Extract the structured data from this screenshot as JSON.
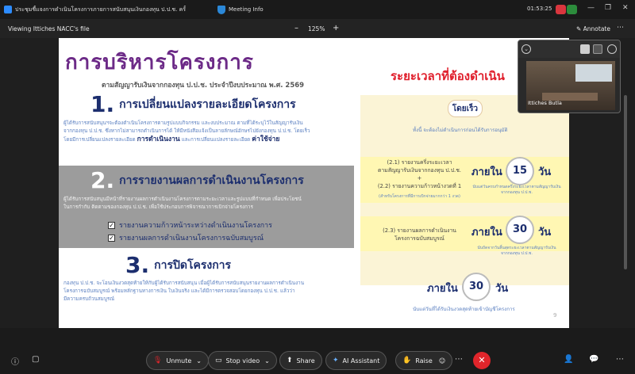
{
  "window": {
    "title": "ประชุมชี้แจงการดำเนินโครงการภายการสนับสนุนเงินกองทุน ป.ป.ช. ครั้งที่ 1/2...",
    "meeting_info": "Meeting Info",
    "time": "01:53:25"
  },
  "viewbar": {
    "viewing": "Viewing Ittiches NACC's file",
    "zoom": "125%",
    "annotate": "Annotate"
  },
  "slide": {
    "title": "การบริหารโครงการ",
    "subtitle": "ตามสัญญารับเงินจากกองทุน ป.ป.ช. ประจำปีงบประมาณ พ.ศ. 2569",
    "s1": {
      "num": "1.",
      "heading": "การเปลี่ยนแปลงรายละเอียดโครงการ",
      "body1": "ผู้ได้รับการสนับสนุนฯจะต้องดำเนินโครงการตามรูปแบบกิจกรรม และงบประมาณ ตามที่ได้ระบุไว้ในสัญญารับเงิน",
      "body2": "จากกองทุน ป.ป.ช. ซึ่งหากไม่สามารถดำเนินการได้ ให้มีหนังสือแจ้งเป็นลายลักษณ์อักษรไปยังกองทุน ป.ป.ช. โดยเร็ว",
      "body3": "โดยมีการเปลี่ยนแปลงรายละเอียด",
      "hl1": "การดำเนินงาน",
      "mid": "และการเปลี่ยนแปลงรายละเอียด",
      "hl2": "ค่าใช้จ่าย"
    },
    "s2": {
      "num": "2.",
      "heading": "การรายงานผลการดำเนินงานโครงการ",
      "body1": "ผู้ได้รับการสนับสนุนมีหน้าที่รายงานผลการดำเนินงานโครงการตามระยะเวลาและรูปแบบที่กำหนด เพื่อประโยชน์",
      "body2": "ในการกำกับ ติดตามของกองทุน ป.ป.ช. เพื่อใช้ประกอบการพิจารณาการเบิกจ่ายโครงการ",
      "check1": "รายงานความก้าวหน้าระหว่างดำเนินงานโครงการ",
      "check2": "รายงานผลการดำเนินงานโครงการฉบับสมบูรณ์"
    },
    "s3": {
      "num": "3.",
      "heading": "การปิดโครงการ",
      "body1": "กองทุน ป.ป.ช. จะโอนเงินงวดสุดท้ายให้กับผู้ได้รับการสนับสนุน เมื่อผู้ได้รับการสนับสนุนรายงานผลการดำเนินงาน",
      "body2": "โครงการฉบับสมบูรณ์ พร้อมหลักฐานทางการเงิน ใบเงินจริง และได้มีการตรวจสอบโดยกองทุน ป.ป.ช. แล้วว่า",
      "body3": "มีความครบถ้วนสมบูรณ์"
    },
    "right": {
      "title": "ระยะเวลาที่ต้องดำเนิน",
      "badge": "โดยเร็ว",
      "asap_note": "ทั้งนี้ จะต้องไม่ดำเนินการก่อนได้รับการอนุมัติ",
      "r1_line1": "(2.1) รายงานครึ่งระยะเวลา",
      "r1_line2": "ตามสัญญารับเงินจากกองทุน ป.ป.ช.",
      "plus": "+",
      "r1_line3": "(2.2) รายงานความก้าวหน้างวดที่ 1",
      "r1_note": "(สำหรับโครงการที่มีการเบิกจ่ายมากกว่า 1 งวด)",
      "within": "ภายใน",
      "day": "วัน",
      "n1": "15",
      "n1_note1": "นับแต่วันครบกำหนดครึ่งระยะเวลาตามสัญญารับเงิน",
      "n1_note2": "จากกองทุน ป.ป.ช.",
      "r2_line1": "(2.3) รายงานผลการดำเนินงาน",
      "r2_line2": "โครงการฉบับสมบูรณ์",
      "n2": "30",
      "n2_note1": "นับถัดจากวันสิ้นสุดระยะเวลาตามสัญญารับเงิน",
      "n2_note2": "จากกองทุน ป.ป.ช.",
      "n3": "30",
      "n3_note": "นับแต่วันที่ได้รับเงินงวดสุดท้ายเข้าบัญชีโครงการ"
    },
    "page": "9"
  },
  "video": {
    "name": "Ittiches Butla"
  },
  "controls": {
    "unmute": "Unmute",
    "stop_video": "Stop video",
    "share": "Share",
    "ai": "AI Assistant",
    "raise": "Raise"
  },
  "colors": {
    "title_purple": "#6c2a87",
    "navy": "#1c2e6e",
    "red": "#e01e2b",
    "end_red": "#e0252b"
  }
}
